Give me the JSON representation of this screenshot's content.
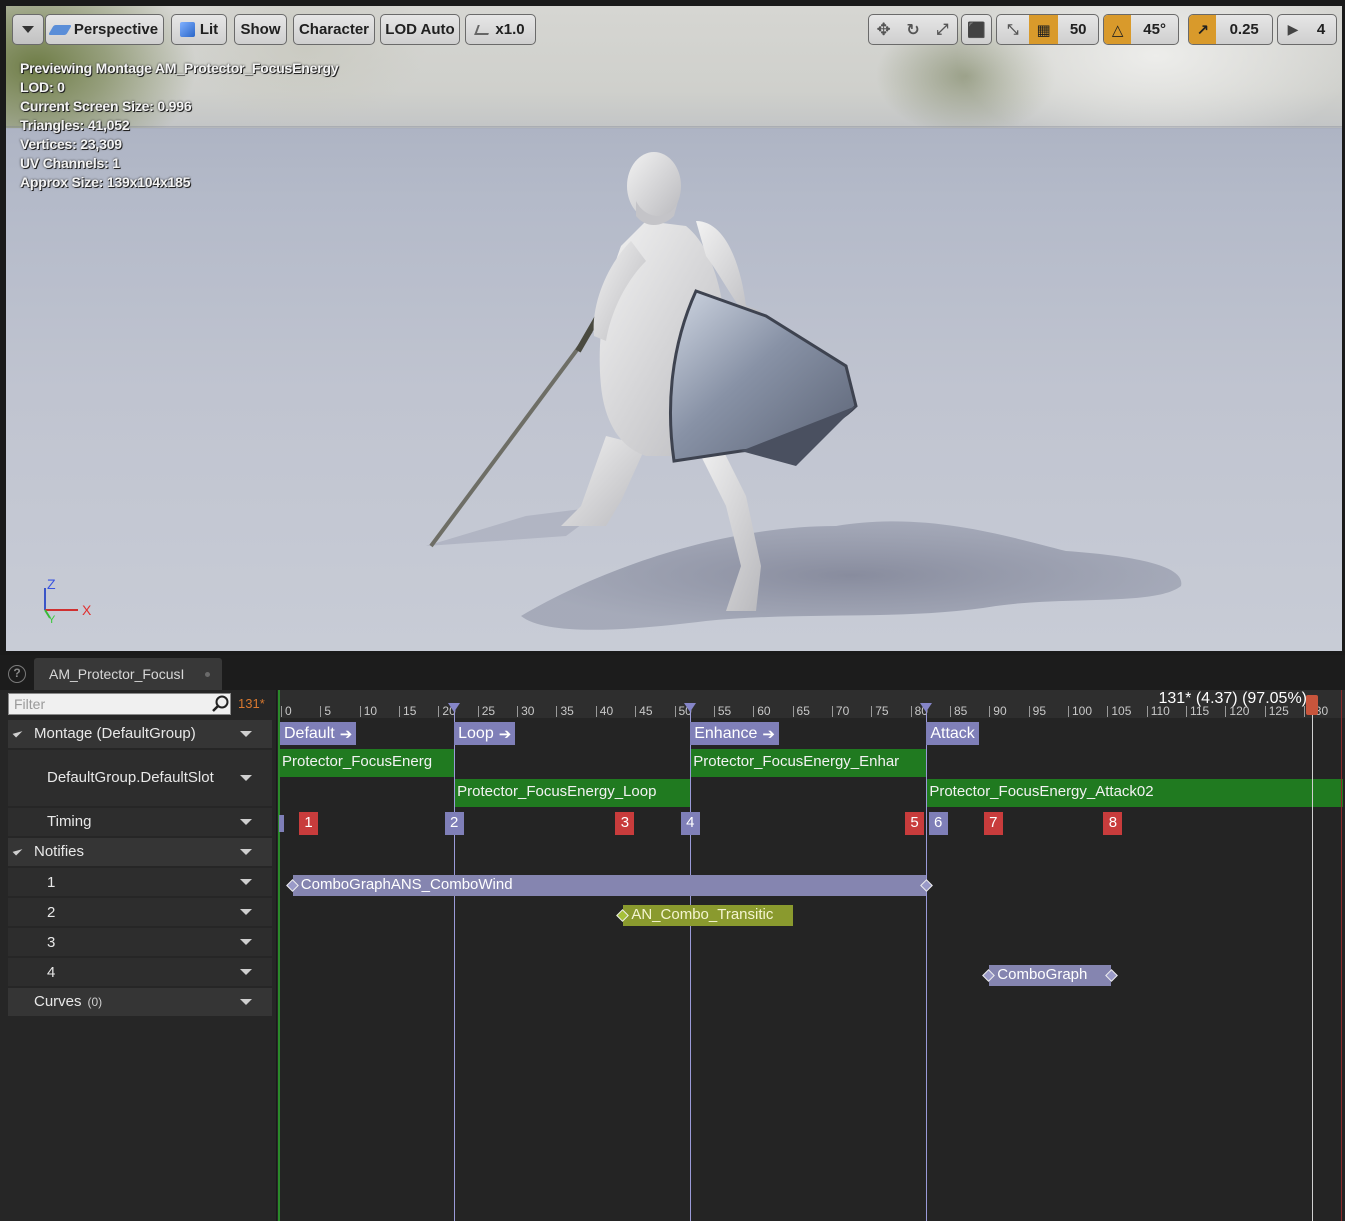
{
  "viewport": {
    "toolbar": {
      "perspective_label": "Perspective",
      "lit_label": "Lit",
      "show_label": "Show",
      "character_label": "Character",
      "lod_label": "LOD Auto",
      "speed_label": "x1.0",
      "grid_snap_value": "50",
      "rotation_snap_value": "45°",
      "scale_snap_value": "0.25",
      "camera_speed_value": "4"
    },
    "stats": [
      "Previewing Montage AM_Protector_FocusEnergy",
      "LOD: 0",
      "Current Screen Size: 0.996",
      "Triangles: 41,052",
      "Vertices: 23,309",
      "UV Channels: 1",
      "Approx Size: 139x104x185"
    ],
    "axes": {
      "z": "Z",
      "x": "X",
      "y": "Y"
    }
  },
  "panel": {
    "tab_title": "AM_Protector_FocusI",
    "filter_placeholder": "Filter",
    "frame_count": "131*",
    "tracks": {
      "montage": "Montage (DefaultGroup)",
      "slot": "DefaultGroup.DefaultSlot",
      "timing": "Timing",
      "notifies": "Notifies",
      "notify_1": "1",
      "notify_2": "2",
      "notify_3": "3",
      "notify_4": "4",
      "curves": "Curves",
      "curves_count": "(0)"
    }
  },
  "timeline": {
    "readout": "131* (4.37) (97.05%)",
    "ticks": [
      "0",
      "5",
      "10",
      "15",
      "20",
      "25",
      "30",
      "35",
      "40",
      "45",
      "50",
      "55",
      "60",
      "65",
      "70",
      "75",
      "80",
      "85",
      "90",
      "95",
      "100",
      "105",
      "110",
      "115",
      "120",
      "125",
      "130"
    ],
    "sections": [
      {
        "label": "Default",
        "frame": 0
      },
      {
        "label": "Loop",
        "frame": 22
      },
      {
        "label": "Enhance",
        "frame": 52
      },
      {
        "label": "Attack",
        "frame": 82
      }
    ],
    "segments_row1": [
      {
        "label": "Protector_FocusEnerg",
        "start": 0,
        "end": 22
      },
      {
        "label": "Protector_FocusEnergy_Enhar",
        "start": 52,
        "end": 82
      }
    ],
    "segments_row2": [
      {
        "label": "Protector_FocusEnergy_Loop",
        "start": 22,
        "end": 52
      },
      {
        "label": "Protector_FocusEnergy_Attack02",
        "start": 82,
        "end": 135
      }
    ],
    "timing_markers": [
      {
        "label": "1",
        "color": "red",
        "frame": 2.3
      },
      {
        "label": "2",
        "color": "blue",
        "frame": 20.8
      },
      {
        "label": "3",
        "color": "red",
        "frame": 42.5
      },
      {
        "label": "4",
        "color": "blue",
        "frame": 50.8
      },
      {
        "label": "5",
        "color": "red",
        "frame": 79.3
      },
      {
        "label": "6",
        "color": "blue",
        "frame": 82.3
      },
      {
        "label": "7",
        "color": "red",
        "frame": 89.3
      },
      {
        "label": "8",
        "color": "red",
        "frame": 104.5
      }
    ],
    "notifies": [
      {
        "track": 1,
        "label": "ComboGraphANS_ComboWind",
        "type": "state",
        "start": 1.5,
        "end": 82
      },
      {
        "track": 2,
        "label": "AN_Combo_Transitic",
        "type": "event",
        "start": 43.5,
        "end": 65
      },
      {
        "track": 4,
        "label": "ComboGraph",
        "type": "state",
        "start": 90,
        "end": 105.5
      }
    ],
    "playhead_frame": 131
  }
}
